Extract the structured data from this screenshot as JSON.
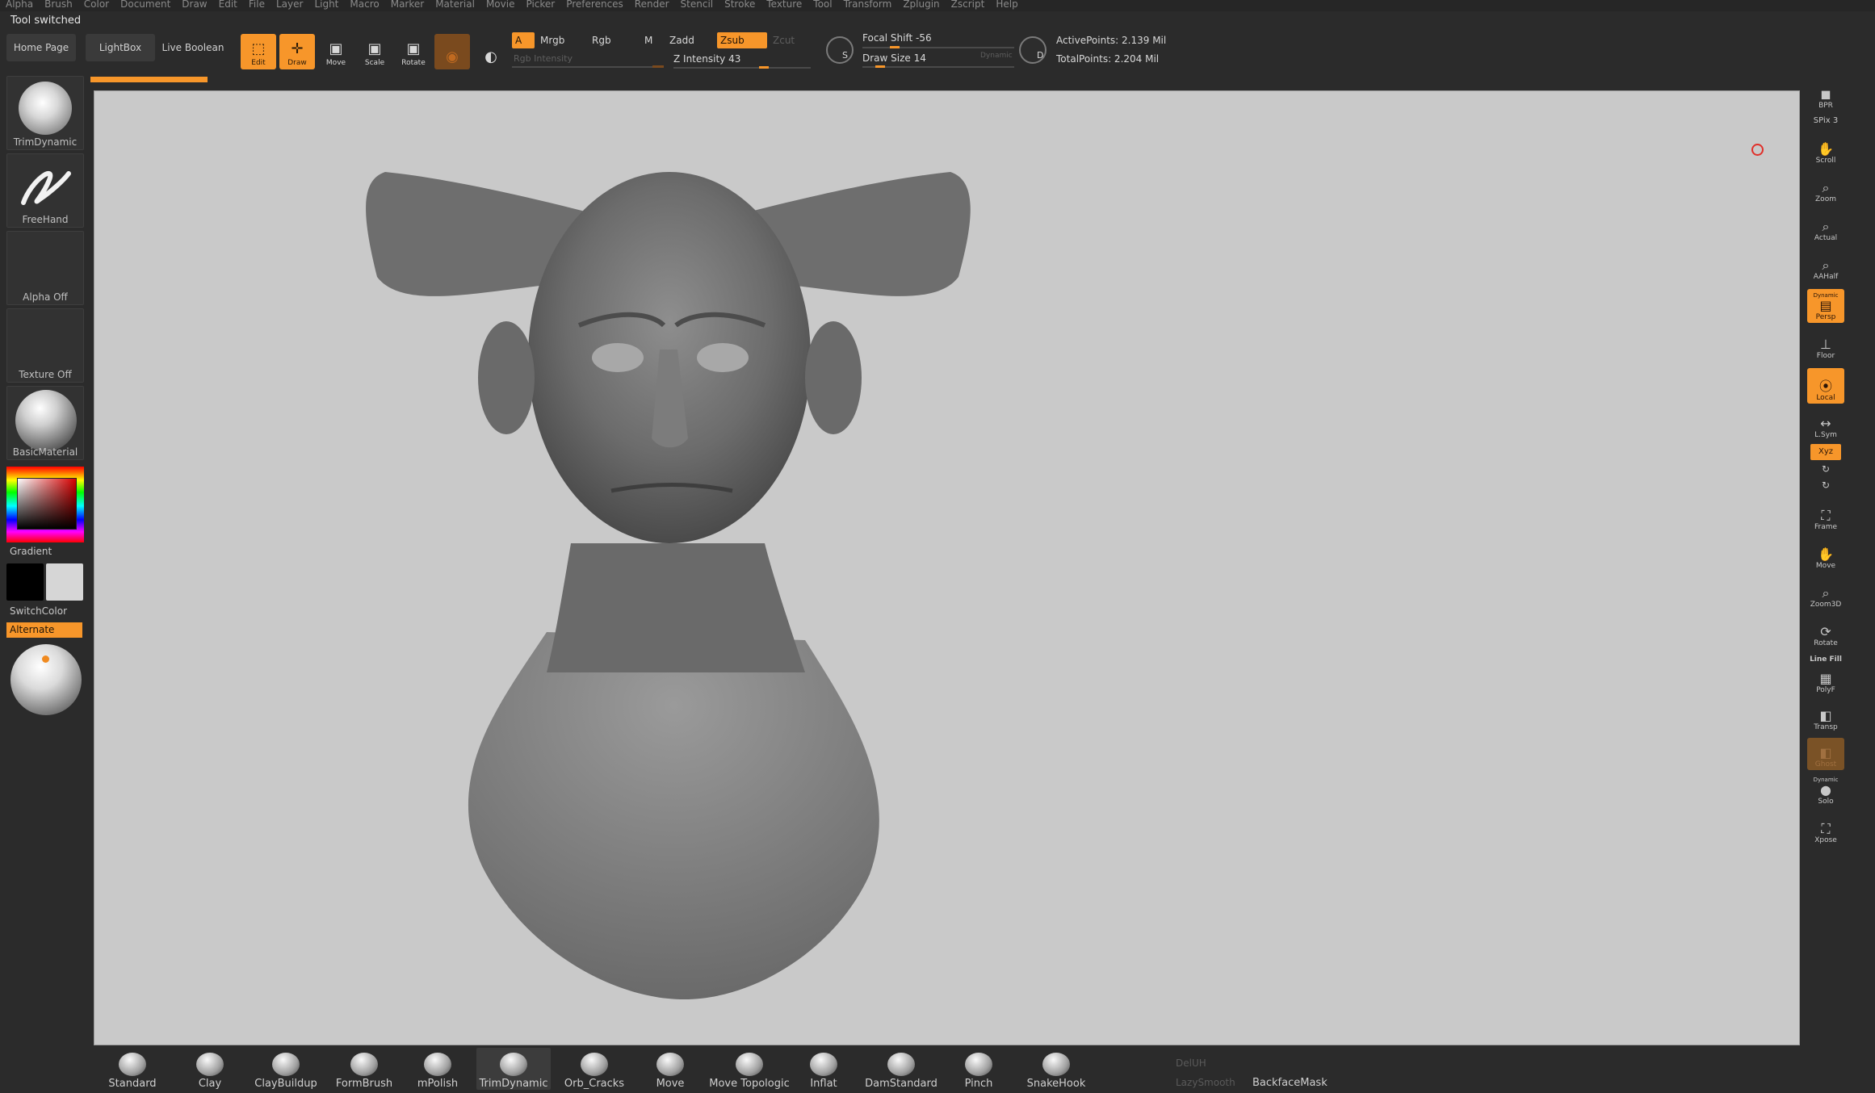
{
  "menu": [
    "Alpha",
    "Brush",
    "Color",
    "Document",
    "Draw",
    "Edit",
    "File",
    "Layer",
    "Light",
    "Macro",
    "Marker",
    "Material",
    "Movie",
    "Picker",
    "Preferences",
    "Render",
    "Stencil",
    "Stroke",
    "Texture",
    "Tool",
    "Transform",
    "Zplugin",
    "Zscript",
    "Help"
  ],
  "status": "Tool switched",
  "top": {
    "home_page": "Home Page",
    "lightbox": "LightBox",
    "live_boolean": "Live Boolean",
    "edit": "Edit",
    "draw": "Draw",
    "move": "Move",
    "scale": "Scale",
    "rotate": "Rotate",
    "a_toggle": "A",
    "mrgb": "Mrgb",
    "rgb": "Rgb",
    "m": "M",
    "zadd": "Zadd",
    "zsub": "Zsub",
    "zcut": "Zcut",
    "rgb_intensity": "Rgb Intensity",
    "z_intensity": "Z Intensity 43",
    "focal_shift": "Focal Shift -56",
    "draw_size": "Draw Size 14",
    "dynamic": "Dynamic",
    "active_points": "ActivePoints: 2.139 Mil",
    "total_points": "TotalPoints: 2.204 Mil",
    "s_label": "S",
    "d_label": "D"
  },
  "left": {
    "brush": "TrimDynamic",
    "stroke": "FreeHand",
    "alpha": "Alpha Off",
    "texture": "Texture Off",
    "material": "BasicMaterial",
    "gradient": "Gradient",
    "switch_color": "SwitchColor",
    "alternate": "Alternate"
  },
  "right": {
    "bpr": "BPR",
    "spix": "SPix 3",
    "scroll": "Scroll",
    "zoom": "Zoom",
    "actual": "Actual",
    "aahalf": "AAHalf",
    "dynamic": "Dynamic",
    "persp": "Persp",
    "floor": "Floor",
    "local": "Local",
    "lsym": "L.Sym",
    "xyz": "Xyz",
    "frame": "Frame",
    "move": "Move",
    "zoom3d": "Zoom3D",
    "rotate": "Rotate",
    "line_fill": "Line Fill",
    "polyf": "PolyF",
    "transp": "Transp",
    "ghost": "Ghost",
    "solo": "Solo",
    "xpose": "Xpose"
  },
  "brushes": [
    "Standard",
    "Clay",
    "ClayBuildup",
    "FormBrush",
    "mPolish",
    "TrimDynamic",
    "Orb_Cracks",
    "Move",
    "Move Topologic",
    "Inflat",
    "DamStandard",
    "Pinch",
    "SnakeHook"
  ],
  "bottom_stats": {
    "delh": "DelUH",
    "lazy": "LazySmooth",
    "backface": "BackfaceMask"
  },
  "colors": {
    "accent": "#f7962a",
    "viewport_bg": "#c9c9c9"
  }
}
